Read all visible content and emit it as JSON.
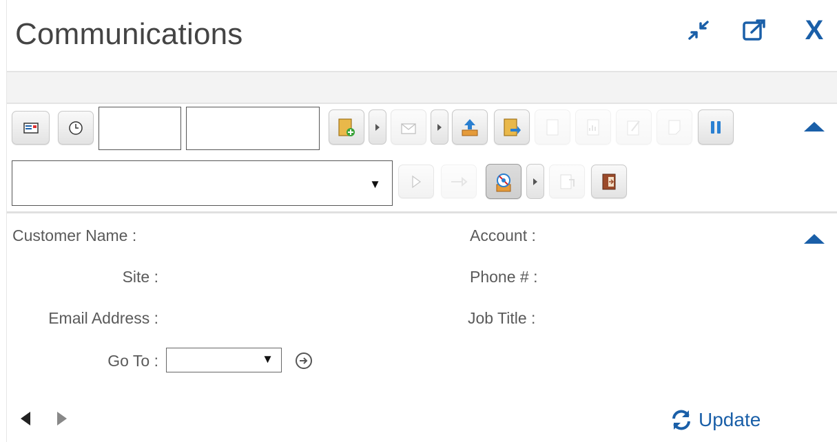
{
  "header": {
    "title": "Communications",
    "close_label": "X",
    "icons": {
      "collapse": "collapse-arrows-icon",
      "popout": "popout-icon"
    }
  },
  "toolbar": {
    "row1_input1_value": "",
    "row1_input2_value": "",
    "row2_select_value": "",
    "row2_select_caret": "▼",
    "icons": [
      "email-icon",
      "history-icon",
      "new-envelope-icon",
      "mail-icon",
      "upload-icon",
      "forward-folder-icon",
      "document-icon",
      "document-chart-icon",
      "edit-icon",
      "notes-icon",
      "pause-icon",
      "play-icon",
      "redirect-icon",
      "alarm-icon",
      "transfer-icon",
      "exit-door-icon"
    ]
  },
  "customer": {
    "name_label": "Customer Name :",
    "site_label": "Site :",
    "email_label": "Email Address :",
    "account_label": "Account :",
    "phone_label": "Phone # :",
    "job_title_label": "Job Title :",
    "goto_label": "Go To :",
    "goto_value": "",
    "goto_caret": "▼"
  },
  "footer": {
    "update_label": "Update"
  },
  "colors": {
    "accent": "#1a5fa8",
    "pause": "#2a80d2"
  }
}
